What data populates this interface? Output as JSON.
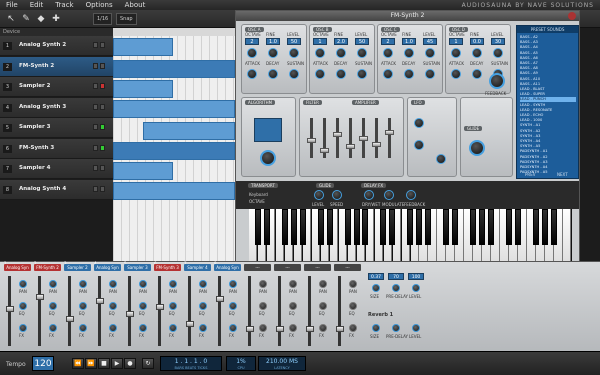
{
  "menu": {
    "items": [
      "File",
      "Edit",
      "Track",
      "Options",
      "About"
    ],
    "brand": "AUDIOSAUNA BY NAVE SOLUTIONS"
  },
  "toolbar": {
    "tools": [
      "pointer-icon",
      "pencil-icon",
      "eraser-icon",
      "move-icon"
    ],
    "quantize": "1/16",
    "snap": "Snap"
  },
  "tracks": {
    "header": "Device",
    "items": [
      {
        "num": "1",
        "name": "Analog Synth 2",
        "rec": "grey"
      },
      {
        "num": "2",
        "name": "FM-Synth 2",
        "rec": "grey",
        "selected": true
      },
      {
        "num": "3",
        "name": "Sampler 2",
        "rec": "red"
      },
      {
        "num": "4",
        "name": "Analog Synth 3",
        "rec": "grey"
      },
      {
        "num": "5",
        "name": "Sampler 3",
        "rec": "green"
      },
      {
        "num": "6",
        "name": "FM-Synth 3",
        "rec": "green"
      },
      {
        "num": "7",
        "name": "Sampler 4",
        "rec": "grey"
      },
      {
        "num": "8",
        "name": "Analog Synth 4",
        "rec": "grey"
      }
    ]
  },
  "synth": {
    "title": "FM-Synth 2",
    "osc_labels": [
      "OSC A",
      "OSC B",
      "OSC C",
      "OSC D"
    ],
    "lcd_values": [
      "2",
      "1.0",
      "50",
      "1",
      "2.0",
      "50",
      "2",
      "1.0",
      "45",
      "1",
      "0.0",
      "30"
    ],
    "knob_labels_top": [
      "OCTAVE",
      "FINE",
      "LEVEL",
      "OCTAVE",
      "FINE",
      "LEVEL",
      "OCTAVE",
      "FINE",
      "LEVEL",
      "OCTAVE",
      "FINE",
      "LEVEL"
    ],
    "knob_labels_env": [
      "ATTACK",
      "DECAY",
      "SUSTAIN",
      "ATTACK",
      "DECAY",
      "SUSTAIN",
      "ATTACK",
      "DECAY",
      "SUSTAIN",
      "ATTACK",
      "DECAY",
      "SUSTAIN"
    ],
    "section_labels": [
      "ALGORITHM",
      "FILTER",
      "AMPLIFIER",
      "LFO",
      "GLIDE"
    ],
    "feedback_label": "FEEDBACK",
    "preset_header": "PRESET SOUNDS",
    "presets": [
      "BASS - A2",
      "BASS - A3",
      "BASS - A4",
      "BASS - A5",
      "BASS - A6",
      "BASS - A7",
      "BASS - A8",
      "BASS - A9",
      "BASS - A10",
      "BASS - A11",
      "LEAD - BLAST",
      "LEAD - SUPER",
      "LEAD - PUNCH",
      "LEAD - SYNTH",
      "LEAD - RESONATE",
      "LEAD - ECHO",
      "LEAD - 1000",
      "SYNTH - A1",
      "SYNTH - A2",
      "SYNTH - A3",
      "SYNTH - A4",
      "SYNTH - A5",
      "PADSYNTH - A1",
      "PADSYNTH - A2",
      "PADSYNTH - A3",
      "PADSYNTH - A4",
      "PADSYNTH - A5"
    ],
    "selected_preset": "LEAD - PUNCH",
    "nav_prev": "PREV",
    "nav_next": "NEXT",
    "strip_labels": [
      "TRANSPORT",
      "GLIDE",
      "DELAY FX"
    ],
    "strip_sub": [
      "Keyboard",
      "OCTAVE"
    ],
    "strip_knob_labels": [
      "LEVEL",
      "SPEED",
      "DRY/WET",
      "MODULATE",
      "FEEDBACK"
    ]
  },
  "mixer": {
    "channels": [
      {
        "num": "1",
        "label": "Analog Syn",
        "color": "red"
      },
      {
        "num": "2",
        "label": "FM-Synth 2",
        "color": "red"
      },
      {
        "num": "3",
        "label": "Sampler 2",
        "color": "blue"
      },
      {
        "num": "4",
        "label": "Analog Syn",
        "color": "blue"
      },
      {
        "num": "5",
        "label": "Sampler 3",
        "color": "blue"
      },
      {
        "num": "6",
        "label": "FM-Synth 3",
        "color": "red"
      },
      {
        "num": "7",
        "label": "Sampler 4",
        "color": "blue"
      },
      {
        "num": "8",
        "label": "Analog Syn",
        "color": "blue"
      },
      {
        "num": "",
        "label": "---",
        "color": "dark"
      },
      {
        "num": "",
        "label": "---",
        "color": "dark"
      },
      {
        "num": "",
        "label": "---",
        "color": "dark"
      },
      {
        "num": "",
        "label": "---",
        "color": "dark"
      }
    ],
    "knob_labels": [
      "PAN",
      "EQ",
      "FX"
    ],
    "reverb": {
      "values": [
        "0.37",
        "70",
        "100"
      ],
      "knob_labels": [
        "SIZE",
        "PRE-DELAY",
        "LEVEL"
      ],
      "title": "Reverb 1",
      "knob_labels_2": [
        "SIZE",
        "PRE-DELAY",
        "LEVEL"
      ]
    }
  },
  "transport": {
    "tempo_label": "Tempo",
    "tempo": "120",
    "buttons": [
      "rewind-icon",
      "fast-forward-icon",
      "stop-icon",
      "play-icon",
      "record-icon"
    ],
    "loop_icon": "loop-icon",
    "position": "1 . 1 . 1 . 0",
    "position_label": "BARS BEATS TICKS",
    "cpu": "1%",
    "cpu_label": "CPU",
    "time": "210.00 MS",
    "time_label": "LATENCY"
  },
  "colors": {
    "accent": "#2f6fa8",
    "clip": "#5e9cd3",
    "record_red": "#c33333",
    "record_green": "#33c033"
  }
}
